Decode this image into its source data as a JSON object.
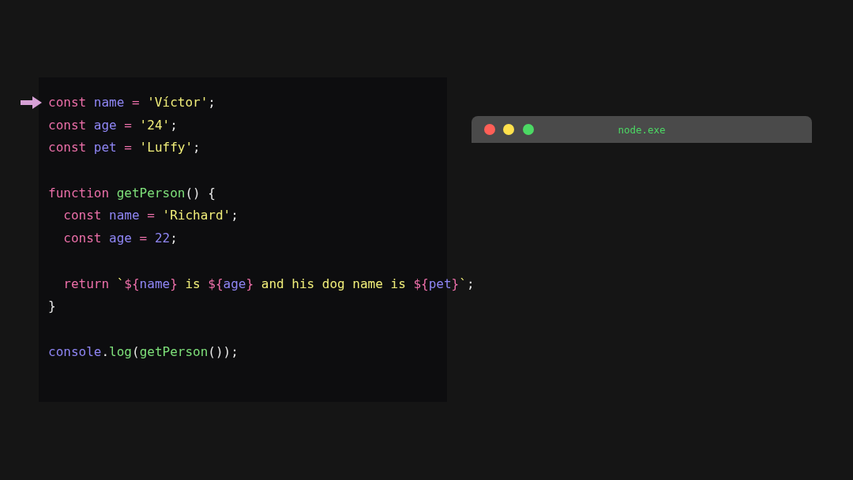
{
  "editor": {
    "lines": [
      {
        "kind": "code",
        "selected": true,
        "tokens": [
          {
            "kind": "keyword",
            "text": "const "
          },
          {
            "kind": "variable",
            "text": "name"
          },
          {
            "kind": "operator",
            "text": " = "
          },
          {
            "kind": "string",
            "text": "'Víctor'"
          },
          {
            "kind": "punct",
            "text": ";"
          }
        ]
      },
      {
        "kind": "code",
        "selected": false,
        "tokens": [
          {
            "kind": "keyword",
            "text": "const "
          },
          {
            "kind": "variable",
            "text": "age"
          },
          {
            "kind": "operator",
            "text": " = "
          },
          {
            "kind": "string",
            "text": "'24'"
          },
          {
            "kind": "punct",
            "text": ";"
          }
        ]
      },
      {
        "kind": "code",
        "selected": false,
        "tokens": [
          {
            "kind": "keyword",
            "text": "const "
          },
          {
            "kind": "variable",
            "text": "pet"
          },
          {
            "kind": "operator",
            "text": " = "
          },
          {
            "kind": "string",
            "text": "'Luffy'"
          },
          {
            "kind": "punct",
            "text": ";"
          }
        ]
      },
      {
        "kind": "blank"
      },
      {
        "kind": "code",
        "selected": false,
        "tokens": [
          {
            "kind": "keyword",
            "text": "function "
          },
          {
            "kind": "function",
            "text": "getPerson"
          },
          {
            "kind": "punct",
            "text": "() {"
          }
        ]
      },
      {
        "kind": "code",
        "selected": false,
        "tokens": [
          {
            "kind": "keyword",
            "text": "  const "
          },
          {
            "kind": "variable",
            "text": "name"
          },
          {
            "kind": "operator",
            "text": " = "
          },
          {
            "kind": "string",
            "text": "'Richard'"
          },
          {
            "kind": "punct",
            "text": ";"
          }
        ]
      },
      {
        "kind": "code",
        "selected": false,
        "tokens": [
          {
            "kind": "keyword",
            "text": "  const "
          },
          {
            "kind": "variable",
            "text": "age"
          },
          {
            "kind": "operator",
            "text": " = "
          },
          {
            "kind": "variable",
            "text": "22"
          },
          {
            "kind": "punct",
            "text": ";"
          }
        ]
      },
      {
        "kind": "blank"
      },
      {
        "kind": "code",
        "selected": false,
        "tokens": [
          {
            "kind": "keyword",
            "text": "  return "
          },
          {
            "kind": "string",
            "text": "`"
          },
          {
            "kind": "keyword",
            "text": "${"
          },
          {
            "kind": "variable",
            "text": "name"
          },
          {
            "kind": "keyword",
            "text": "}"
          },
          {
            "kind": "string",
            "text": " is "
          },
          {
            "kind": "keyword",
            "text": "${"
          },
          {
            "kind": "variable",
            "text": "age"
          },
          {
            "kind": "keyword",
            "text": "}"
          },
          {
            "kind": "string",
            "text": " and his dog name is "
          },
          {
            "kind": "keyword",
            "text": "${"
          },
          {
            "kind": "variable",
            "text": "pet"
          },
          {
            "kind": "keyword",
            "text": "}"
          },
          {
            "kind": "string",
            "text": "`"
          },
          {
            "kind": "punct",
            "text": ";"
          }
        ]
      },
      {
        "kind": "code",
        "selected": false,
        "tokens": [
          {
            "kind": "punct",
            "text": "}"
          }
        ]
      },
      {
        "kind": "blank"
      },
      {
        "kind": "code",
        "selected": false,
        "tokens": [
          {
            "kind": "variable",
            "text": "console"
          },
          {
            "kind": "punct",
            "text": "."
          },
          {
            "kind": "function",
            "text": "log"
          },
          {
            "kind": "punct",
            "text": "("
          },
          {
            "kind": "function",
            "text": "getPerson"
          },
          {
            "kind": "punct",
            "text": "());"
          }
        ]
      }
    ]
  },
  "terminal": {
    "title": "node.exe"
  }
}
